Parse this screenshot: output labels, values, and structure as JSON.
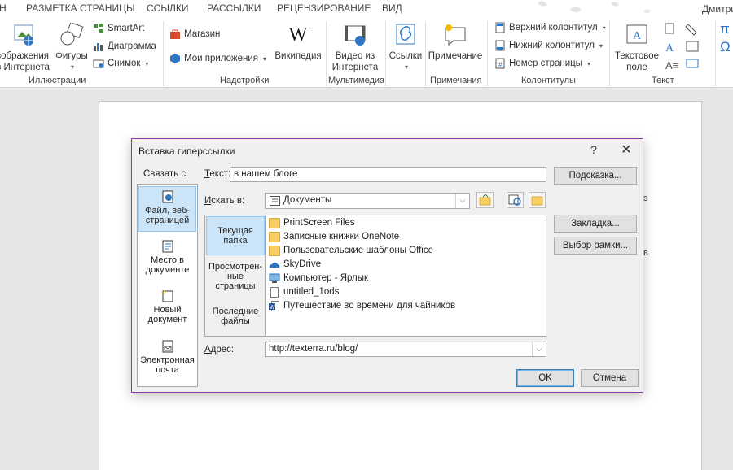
{
  "ribbon_tabs": [
    "Н",
    "РАЗМЕТКА СТРАНИЦЫ",
    "ССЫЛКИ",
    "РАССЫЛКИ",
    "РЕЦЕНЗИРОВАНИЕ",
    "ВИД"
  ],
  "user_name": "Дмитри",
  "groups": {
    "illustrations": {
      "label": "Иллюстрации",
      "images_online": "зображения\nз Интернета",
      "shapes": "Фигуры",
      "smartart": "SmartArt",
      "chart": "Диаграмма",
      "screenshot": "Снимок"
    },
    "addins": {
      "label": "Надстройки",
      "store": "Магазин",
      "my_apps": "Мои приложения",
      "wikipedia": "Википедия"
    },
    "media": {
      "label": "Мультимедиа",
      "online_video": "Видео из\nИнтернета"
    },
    "links": {
      "label": "",
      "links": "Ссылки"
    },
    "comments": {
      "label": "Примечания",
      "comment": "Примечание"
    },
    "header_footer": {
      "label": "Колонтитулы",
      "header": "Верхний колонтитул",
      "footer": "Нижний колонтитул",
      "page_number": "Номер страницы"
    },
    "text": {
      "label": "Текст",
      "textbox": "Текстовое\nполе"
    },
    "symbols": {
      "pi": "π",
      "omega": "Ω"
    }
  },
  "doc_fragments": [
    "э",
    "в"
  ],
  "dialog": {
    "title": "Вставка гиперссылки",
    "help": "?",
    "close": "✕",
    "link_to_label": "Связать с:",
    "text_label_prefix": "Т",
    "text_label_rest": "екст:",
    "text_value": "в нашем блоге",
    "tooltip_btn": "Подсказка...",
    "look_in_label_prefix": "И",
    "look_in_label_rest": "скать в:",
    "look_in_value": "Документы",
    "bookmark_btn": "Закладка...",
    "target_frame_btn": "Выбор рамки...",
    "address_label_prefix": "А",
    "address_label_rest": "дрес:",
    "address_value": "http://texterra.ru/blog/",
    "ok": "OK",
    "cancel": "Отмена",
    "link_to": [
      {
        "label": "Файл, веб-\nстраницей",
        "icon": "web-page-icon",
        "selected": true
      },
      {
        "label": "Место в\nдокументе",
        "icon": "place-in-document-icon",
        "selected": false
      },
      {
        "label": "Новый\nдокумент",
        "icon": "new-document-icon",
        "selected": false
      },
      {
        "label": "Электронная\nпочта",
        "icon": "email-icon",
        "selected": false
      }
    ],
    "nav": [
      {
        "label": "Текущая\nпапка",
        "selected": true
      },
      {
        "label": "Просмотрен-\nные\nстраницы",
        "selected": false
      },
      {
        "label": "Последние\nфайлы",
        "selected": false
      }
    ],
    "files": [
      {
        "name": "PrintScreen Files",
        "icon": "folder-icon"
      },
      {
        "name": "Записные книжки OneNote",
        "icon": "folder-icon"
      },
      {
        "name": "Пользовательские шаблоны Office",
        "icon": "folder-icon"
      },
      {
        "name": "SkyDrive",
        "icon": "skydrive-icon"
      },
      {
        "name": "Компьютер - Ярлык",
        "icon": "computer-shortcut-icon"
      },
      {
        "name": "untitled_1ods",
        "icon": "file-icon"
      },
      {
        "name": "Путешествие во времени для чайников",
        "icon": "word-document-icon"
      }
    ]
  }
}
